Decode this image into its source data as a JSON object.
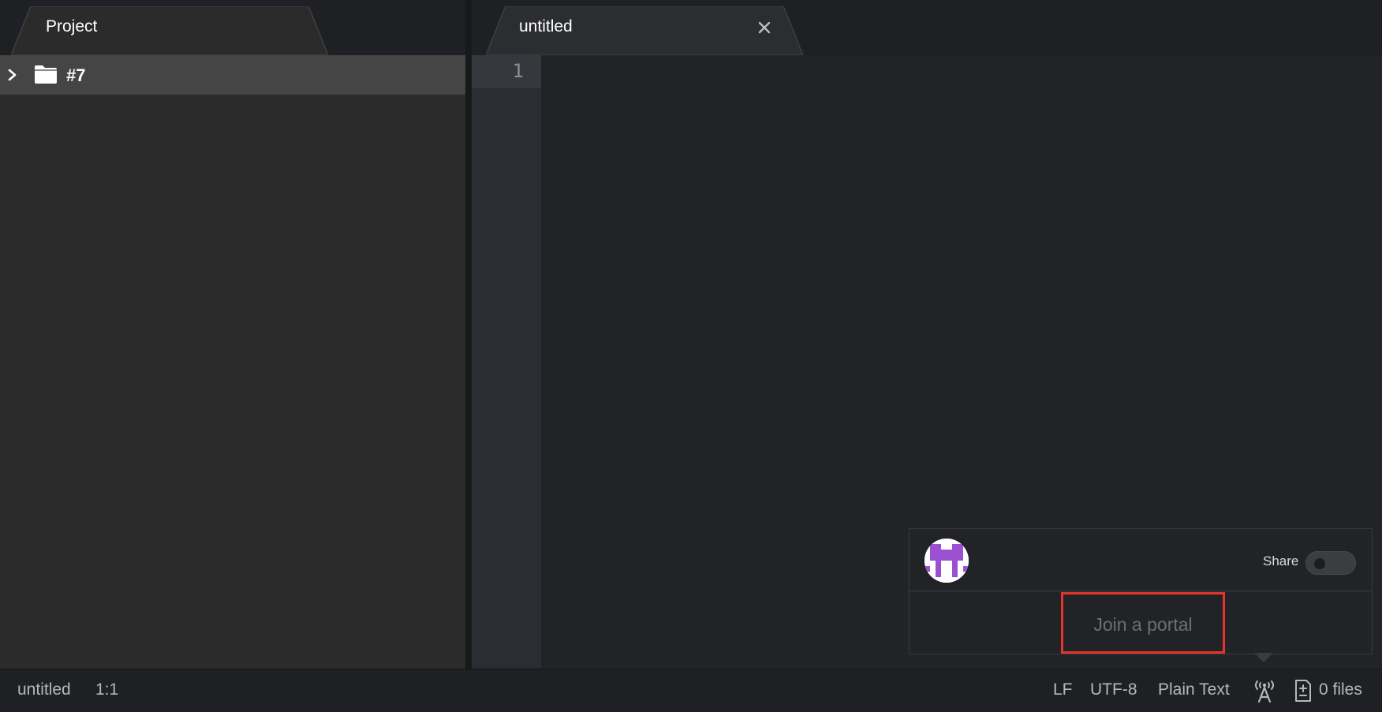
{
  "project_panel": {
    "tab_label": "Project",
    "tree": [
      {
        "label": "#7",
        "icon": "folder-icon",
        "expanded": false
      }
    ]
  },
  "editor": {
    "tab_label": "untitled",
    "line_numbers": [
      "1"
    ]
  },
  "teletype_popover": {
    "share_label": "Share",
    "share_enabled": false,
    "join_placeholder": "Join a portal",
    "avatar_colors": [
      "#9b4fd1",
      "#ffffff"
    ]
  },
  "status_bar": {
    "file_name": "untitled",
    "cursor_position": "1:1",
    "line_ending": "LF",
    "encoding": "UTF-8",
    "grammar": "Plain Text",
    "files_count": "0 files"
  },
  "colors": {
    "highlight_border": "#e5342b",
    "avatar_purple": "#9b4fd1"
  }
}
